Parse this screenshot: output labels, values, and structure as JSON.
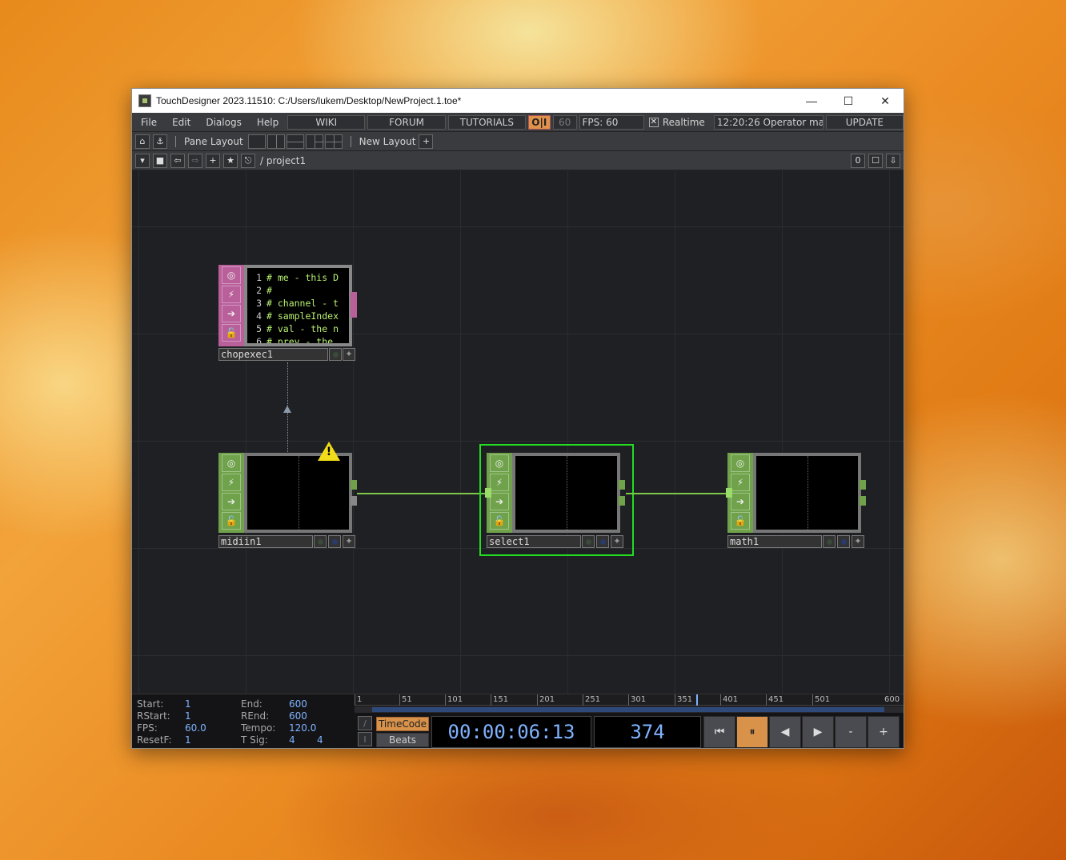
{
  "window": {
    "title": "TouchDesigner 2023.11510: C:/Users/lukem/Desktop/NewProject.1.toe*",
    "minimize": "—",
    "maximize": "☐",
    "close": "✕"
  },
  "menu": {
    "items": [
      "File",
      "Edit",
      "Dialogs",
      "Help"
    ],
    "wiki": "WIKI",
    "forum": "FORUM",
    "tutorials": "TUTORIALS",
    "oi": "O|I",
    "fps_limit": "60",
    "fps_label": "FPS:  60",
    "realtime_check": "✕",
    "realtime": "Realtime",
    "status": "12:20:26 Operator ma",
    "update": "UPDATE"
  },
  "toolbar": {
    "pane_layout": "Pane Layout",
    "new_layout": "New Layout",
    "add": "+"
  },
  "pathbar": {
    "path": "/ project1",
    "zero": "0"
  },
  "nodes": {
    "chopexec": {
      "label": "chopexec1",
      "code": [
        {
          "n": "1",
          "t": "# me - this D"
        },
        {
          "n": "2",
          "t": "#"
        },
        {
          "n": "3",
          "t": "# channel - t"
        },
        {
          "n": "4",
          "t": "# sampleIndex"
        },
        {
          "n": "5",
          "t": "# val - the n"
        },
        {
          "n": "6",
          "t": "# prev - the "
        }
      ]
    },
    "midiin": {
      "label": "midiin1",
      "warning": "!"
    },
    "select": {
      "label": "select1"
    },
    "math": {
      "label": "math1"
    }
  },
  "timeline": {
    "start_label": "Start:",
    "start": "1",
    "rstart_label": "RStart:",
    "rstart": "1",
    "fps_label": "FPS:",
    "fps": "60.0",
    "resetf_label": "ResetF:",
    "resetf": "1",
    "end_label": "End:",
    "end": "600",
    "rend_label": "REnd:",
    "rend": "600",
    "tempo_label": "Tempo:",
    "tempo": "120.0",
    "tsig_label": "T Sig:",
    "tsig_a": "4",
    "tsig_b": "4",
    "ticks": [
      "1",
      "51",
      "101",
      "151",
      "201",
      "251",
      "301",
      "351",
      "401",
      "451",
      "501",
      "600"
    ],
    "current_frame_fraction": 0.623,
    "timecode_btn": "TimeCode",
    "beats_btn": "Beats",
    "slash": "/",
    "bar": "I",
    "timecode": "00:00:06:13",
    "frame": "374",
    "transport": {
      "rewind": "⏮",
      "pause": "⏸",
      "back": "◀",
      "forward": "▶",
      "minus": "-",
      "plus": "+"
    }
  },
  "colors": {
    "chop_green": "#6fa24a",
    "dat_purple": "#b9609b",
    "selected": "#22dd22",
    "wire": "#7dc84a"
  }
}
